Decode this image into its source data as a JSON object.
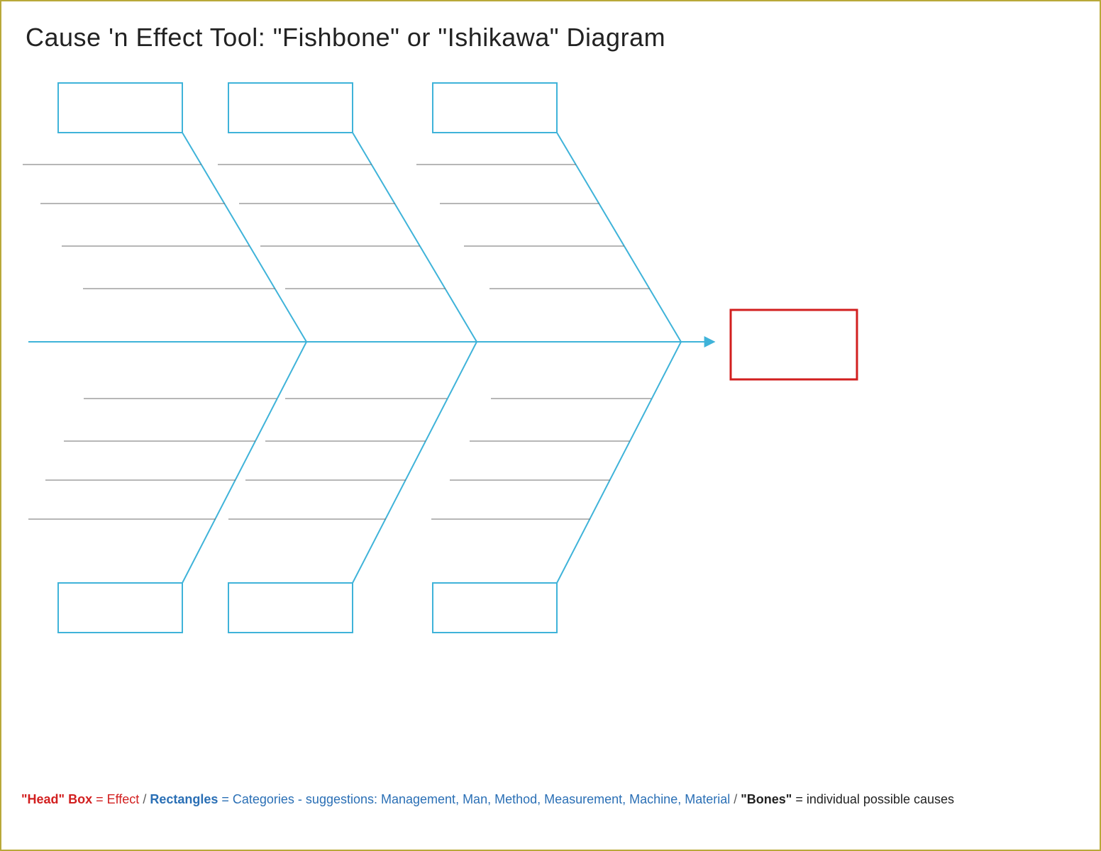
{
  "title": "Cause 'n Effect Tool:   \"Fishbone\" or \"Ishikawa\"  Diagram",
  "legend": {
    "headLabel": "\"Head\" Box",
    "headEquals": " = Effect",
    "sep1": "  /  ",
    "rectLabel": "Rectangles",
    "rectEquals": " = Categories -  suggestions: Management, Man, Method, Measurement, Machine, Material",
    "sep2": "  /  ",
    "bonesLabel": "\"Bones\"",
    "bonesEquals": "  = individual possible causes"
  },
  "colors": {
    "bone": "#3fb3d9",
    "headBox": "#d21f1f",
    "causeLine": "#6f6f6f",
    "border": "#b9a93a"
  },
  "diagram": {
    "type": "fishbone",
    "topCategories": 3,
    "bottomCategories": 3,
    "causeLinesPerBone": 4,
    "effectLabel": "",
    "categoryLabels": [
      "",
      "",
      "",
      "",
      "",
      ""
    ]
  }
}
